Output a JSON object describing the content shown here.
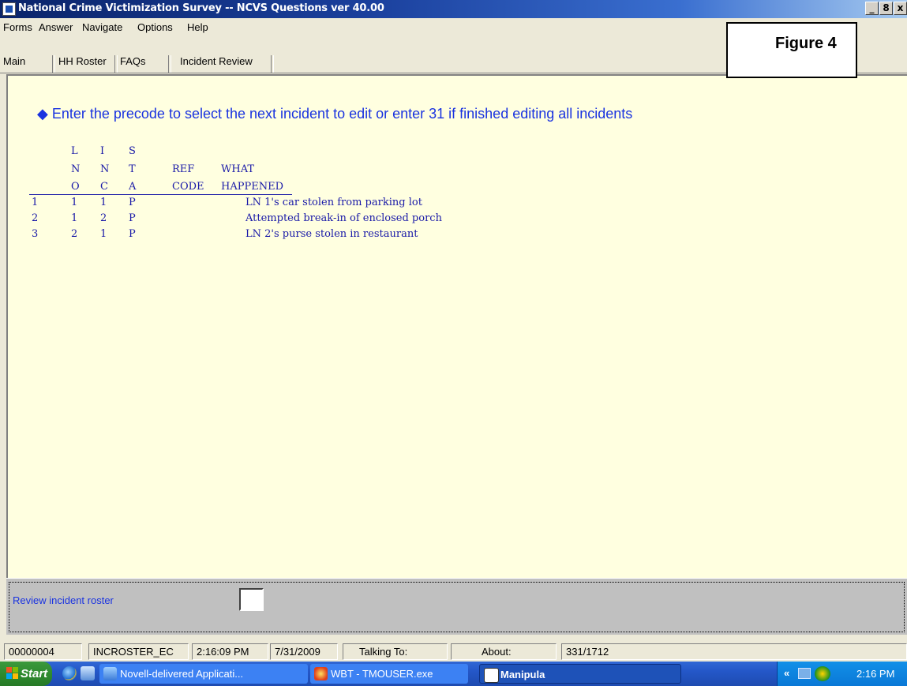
{
  "window": {
    "title": "National Crime Victimization Survey -- NCVS Questions ver 40.00",
    "buttons": [
      "_",
      "8",
      "x"
    ]
  },
  "menu": [
    "Forms",
    "Answer",
    "Navigate",
    "Options",
    "Help"
  ],
  "tabs": [
    "Main",
    "HH Roster",
    "FAQs",
    "Incident Review"
  ],
  "annotation_label": "Figure 4",
  "question": "◆ Enter the precode to select the next incident to edit or enter 31 if finished editing all incidents",
  "roster": {
    "headers": {
      "lno": [
        "L",
        "N",
        "O"
      ],
      "inc": [
        "I",
        "N",
        "C"
      ],
      "sta": [
        "S",
        "T",
        "A"
      ],
      "ref": [
        "REF",
        "CODE"
      ],
      "what": [
        "WHAT",
        "HAPPENED"
      ]
    },
    "rows": [
      {
        "num": "1",
        "lno": "1",
        "inc": "1",
        "sta": "P",
        "ref": "",
        "what": "LN 1's car stolen from parking lot"
      },
      {
        "num": "2",
        "lno": "1",
        "inc": "2",
        "sta": "P",
        "ref": "",
        "what": "Attempted break-in of enclosed porch"
      },
      {
        "num": "3",
        "lno": "2",
        "inc": "1",
        "sta": "P",
        "ref": "",
        "what": "LN 2's purse stolen in restaurant"
      }
    ]
  },
  "field": {
    "prompt": "Review incident roster",
    "value": ""
  },
  "status": {
    "id": "00000004",
    "field_name": "INCROSTER_EC",
    "time": "2:16:09 PM",
    "date": "7/31/2009",
    "talking_to": "Talking To:",
    "about": "About:",
    "counter": "331/1712"
  },
  "taskbar": {
    "start": "Start",
    "items": [
      "Novell-delivered Applicati...",
      "WBT - TMOUSER.exe",
      "Manipula"
    ],
    "clock": "2:16 PM",
    "tray_chevron": "«"
  },
  "colors": {
    "content_bg": "#ffffe0",
    "question_text": "#1a33e0",
    "roster_text": "#1a1aa8",
    "titlebar": "#0a246a"
  }
}
